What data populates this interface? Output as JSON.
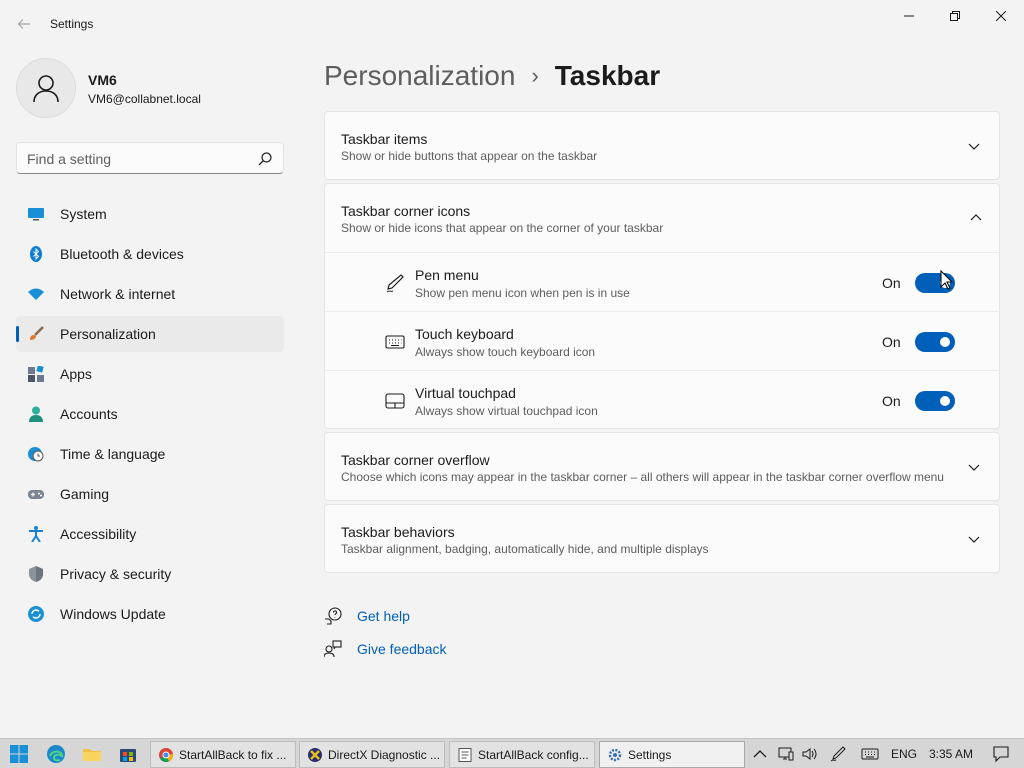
{
  "window": {
    "title": "Settings"
  },
  "user": {
    "name": "VM6",
    "email": "VM6@collabnet.local"
  },
  "search": {
    "placeholder": "Find a setting"
  },
  "nav": [
    {
      "label": "System",
      "icon": "monitor-icon"
    },
    {
      "label": "Bluetooth & devices",
      "icon": "bluetooth-icon"
    },
    {
      "label": "Network & internet",
      "icon": "wifi-icon"
    },
    {
      "label": "Personalization",
      "icon": "paintbrush-icon",
      "selected": true
    },
    {
      "label": "Apps",
      "icon": "apps-icon"
    },
    {
      "label": "Accounts",
      "icon": "person-icon"
    },
    {
      "label": "Time & language",
      "icon": "clock-globe-icon"
    },
    {
      "label": "Gaming",
      "icon": "gamepad-icon"
    },
    {
      "label": "Accessibility",
      "icon": "accessibility-icon"
    },
    {
      "label": "Privacy & security",
      "icon": "shield-icon"
    },
    {
      "label": "Windows Update",
      "icon": "update-icon"
    }
  ],
  "breadcrumb": {
    "parent": "Personalization",
    "separator": "›",
    "current": "Taskbar"
  },
  "sections": {
    "items": {
      "title": "Taskbar items",
      "desc": "Show or hide buttons that appear on the taskbar"
    },
    "corner_icons": {
      "title": "Taskbar corner icons",
      "desc": "Show or hide icons that appear on the corner of your taskbar",
      "rows": [
        {
          "title": "Pen menu",
          "desc": "Show pen menu icon when pen is in use",
          "state": "On",
          "icon": "pen-icon"
        },
        {
          "title": "Touch keyboard",
          "desc": "Always show touch keyboard icon",
          "state": "On",
          "icon": "keyboard-icon"
        },
        {
          "title": "Virtual touchpad",
          "desc": "Always show virtual touchpad icon",
          "state": "On",
          "icon": "touchpad-icon"
        }
      ]
    },
    "overflow": {
      "title": "Taskbar corner overflow",
      "desc": "Choose which icons may appear in the taskbar corner – all others will appear in the taskbar corner overflow menu"
    },
    "behaviors": {
      "title": "Taskbar behaviors",
      "desc": "Taskbar alignment, badging, automatically hide, and multiple displays"
    }
  },
  "help": {
    "get_help": "Get help",
    "give_feedback": "Give feedback"
  },
  "taskbar": {
    "tasks": [
      {
        "label": "StartAllBack to fix ...",
        "icon": "chrome-icon"
      },
      {
        "label": "DirectX Diagnostic ...",
        "icon": "directx-icon"
      },
      {
        "label": "StartAllBack config...",
        "icon": "config-icon"
      },
      {
        "label": "Settings",
        "icon": "settings-gear-icon",
        "active": true
      }
    ],
    "lang": "ENG",
    "time": "3:35 AM"
  },
  "colors": {
    "accent": "#005fb8",
    "background": "#f3f3f3",
    "card": "#fbfbfb"
  }
}
